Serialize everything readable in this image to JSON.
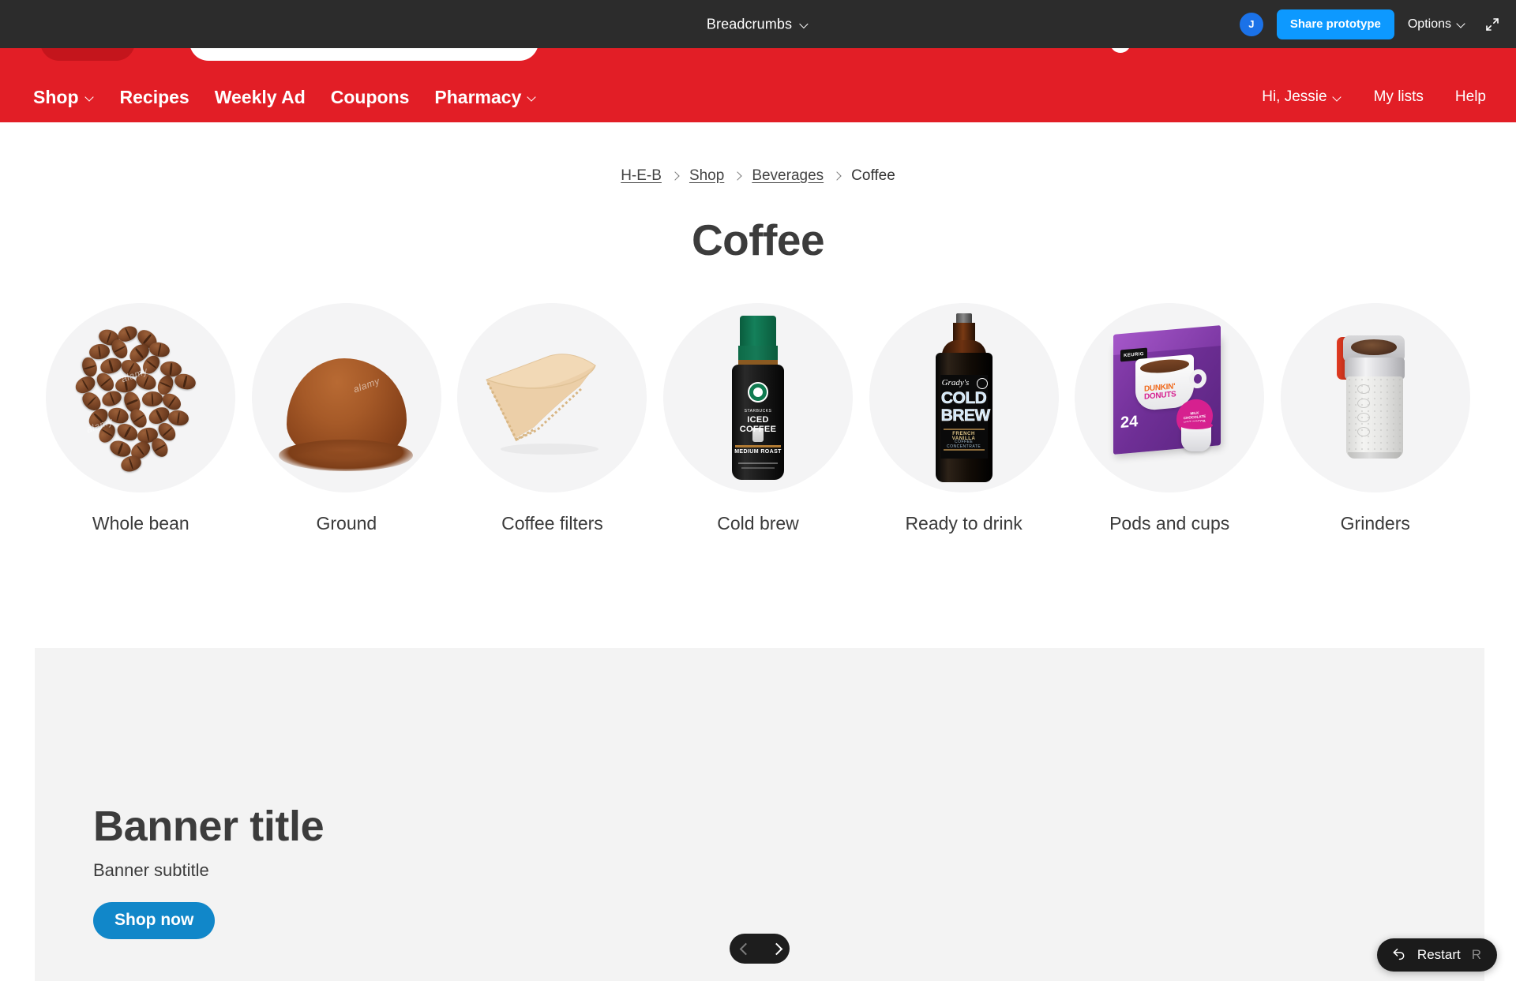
{
  "prototype_bar": {
    "title": "Breadcrumbs",
    "title_chevron_icon": "chevron-down-icon",
    "avatar_initial": "J",
    "share_label": "Share prototype",
    "options_label": "Options",
    "options_chevron_icon": "chevron-down-icon",
    "expand_icon": "expand-diagonal-icon",
    "bar_color": "#2c2c2c",
    "accent_color": "#0d99ff"
  },
  "site_nav": {
    "brand_color": "#e21e26",
    "primary": [
      {
        "label": "Shop",
        "has_chevron": true
      },
      {
        "label": "Recipes",
        "has_chevron": false
      },
      {
        "label": "Weekly Ad",
        "has_chevron": false
      },
      {
        "label": "Coupons",
        "has_chevron": false
      },
      {
        "label": "Pharmacy",
        "has_chevron": true
      }
    ],
    "secondary": [
      {
        "label": "Hi, Jessie",
        "has_chevron": true
      },
      {
        "label": "My lists",
        "has_chevron": false
      },
      {
        "label": "Help",
        "has_chevron": false
      }
    ]
  },
  "breadcrumb": {
    "items": [
      {
        "label": "H-E-B",
        "is_link": true
      },
      {
        "label": "Shop",
        "is_link": true
      },
      {
        "label": "Beverages",
        "is_link": true
      },
      {
        "label": "Coffee",
        "is_link": false
      }
    ],
    "separator_icon": "chevron-right-icon"
  },
  "page": {
    "title": "Coffee"
  },
  "categories": [
    {
      "label": "Whole bean",
      "image": "coffee-beans-pile-photo"
    },
    {
      "label": "Ground",
      "image": "ground-coffee-powder-photo"
    },
    {
      "label": "Coffee filters",
      "image": "paper-coffee-filter-photo"
    },
    {
      "label": "Cold brew",
      "image": "starbucks-iced-coffee-bottle-photo"
    },
    {
      "label": "Ready to drink",
      "image": "gradys-cold-brew-bottle-photo"
    },
    {
      "label": "Pods and cups",
      "image": "dunkin-donuts-keurig-box-photo"
    },
    {
      "label": "Grinders",
      "image": "electric-coffee-grinder-photo"
    }
  ],
  "banner": {
    "title": "Banner title",
    "subtitle": "Banner subtitle",
    "cta_label": "Shop now",
    "cta_color": "#1187c9",
    "background_color": "#f3f3f3",
    "carousel": {
      "prev_icon": "chevron-left-icon",
      "next_icon": "chevron-right-icon"
    }
  },
  "restart": {
    "icon": "undo-arrow-icon",
    "label": "Restart",
    "shortcut": "R"
  },
  "product_art": {
    "starbucks": {
      "brand": "STARBUCKS",
      "name": "ICED COFFEE",
      "roast": "MEDIUM ROAST"
    },
    "gradys": {
      "brand": "Grady's",
      "line1": "COLD",
      "line2": "BREW",
      "flavor": "FRENCH VANILLA",
      "desc": "COFFEE CONCENTRATE"
    },
    "dunkin": {
      "brand1": "DUNKIN'",
      "brand2": "DONUTS",
      "keurig": "KEURIG",
      "count": "24",
      "flavor": "MILK CHOCOLATE HOT COCOA"
    }
  }
}
